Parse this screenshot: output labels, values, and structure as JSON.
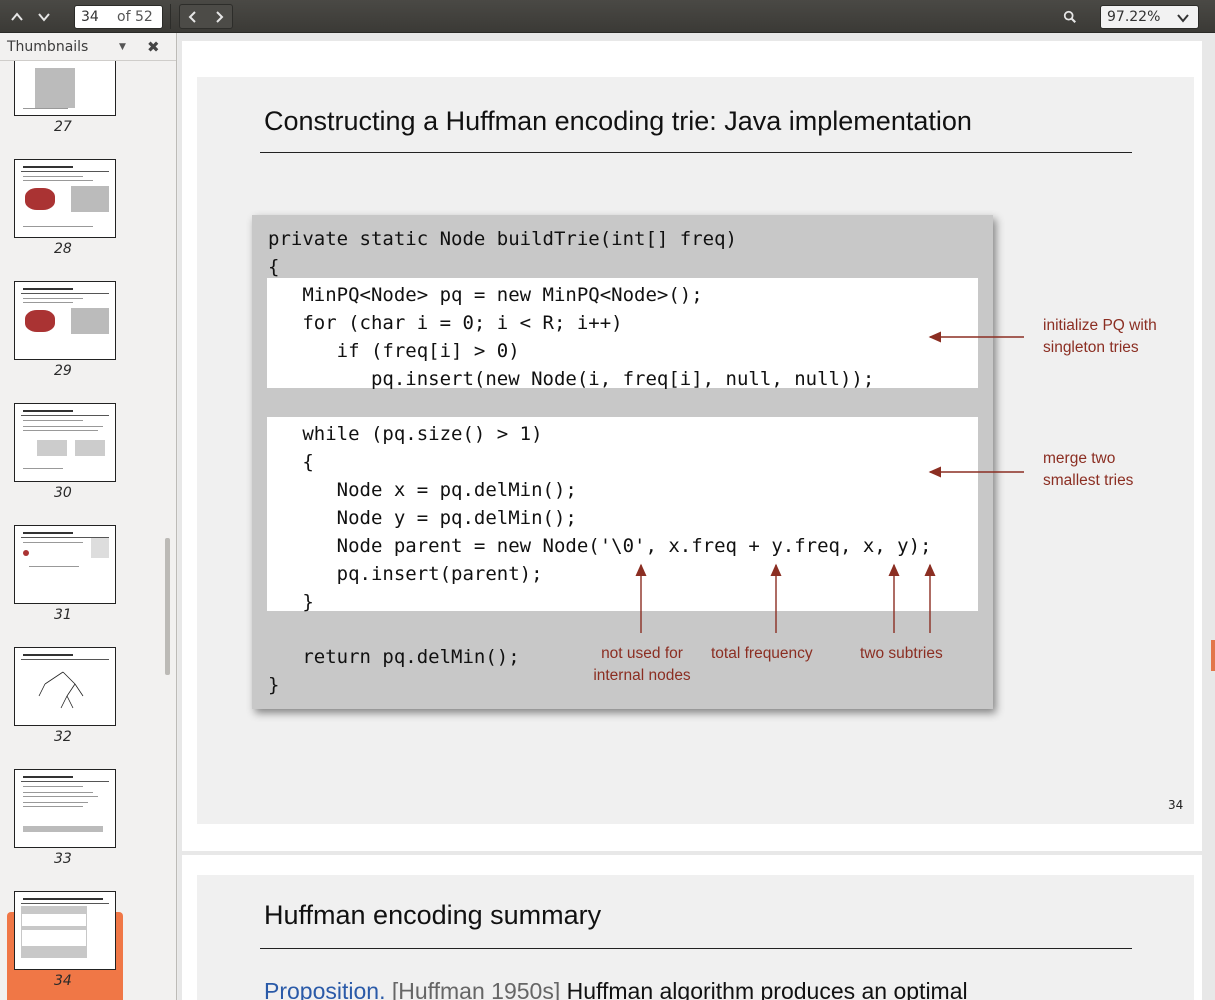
{
  "toolbar": {
    "page_current": "34",
    "page_total": "of 52",
    "zoom": "97.22%"
  },
  "sidebar": {
    "title": "Thumbnails",
    "thumbnails": [
      {
        "num": "27"
      },
      {
        "num": "28"
      },
      {
        "num": "29"
      },
      {
        "num": "30"
      },
      {
        "num": "31"
      },
      {
        "num": "32"
      },
      {
        "num": "33"
      },
      {
        "num": "34",
        "selected": true
      }
    ]
  },
  "slide34": {
    "title": "Constructing a Huffman encoding trie:  Java implementation",
    "code": {
      "line1": "private static Node buildTrie(int[] freq)",
      "line2": "{",
      "line3": "   MinPQ<Node> pq = new MinPQ<Node>();",
      "line4": "   for (char i = 0; i < R; i++)",
      "line5": "      if (freq[i] > 0)",
      "line6": "         pq.insert(new Node(i, freq[i], null, null));",
      "line7": "   while (pq.size() > 1)",
      "line8": "   {",
      "line9": "      Node x = pq.delMin();",
      "line10": "      Node y = pq.delMin();",
      "line11": "      Node parent = new Node('\\0', x.freq + y.freq, x, y);",
      "line12": "      pq.insert(parent);",
      "line13": "   }",
      "line14": "   return pq.delMin();",
      "line15": "}"
    },
    "annotations": {
      "init_pq_1": "initialize PQ with",
      "init_pq_2": "singleton tries",
      "merge_1": "merge two",
      "merge_2": "smallest tries",
      "not_used_1": "not used for",
      "not_used_2": "internal nodes",
      "total_freq": "total frequency",
      "two_subtries": "two subtries"
    },
    "page_number": "34"
  },
  "slide35": {
    "title": "Huffman encoding summary",
    "proposition_label": "Proposition.",
    "citation": "[Huffman 1950s]",
    "text": "Huffman algorithm produces an optimal"
  },
  "colors": {
    "annotation": "#8b2e22",
    "selected_thumb": "#f07746",
    "code_bg": "#c8c8c8"
  }
}
